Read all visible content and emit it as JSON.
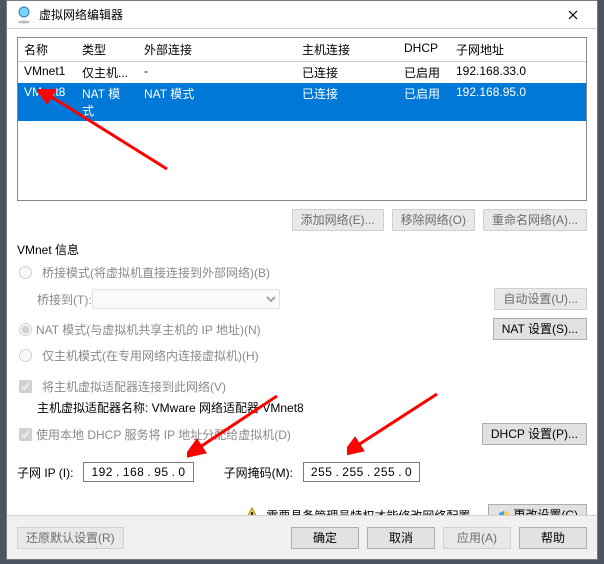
{
  "title": "虚拟网络编辑器",
  "columns": [
    "名称",
    "类型",
    "外部连接",
    "主机连接",
    "DHCP",
    "子网地址"
  ],
  "rows": [
    {
      "name": "VMnet1",
      "type": "仅主机...",
      "ext": "-",
      "host": "已连接",
      "dhcp": "已启用",
      "subnet": "192.168.33.0"
    },
    {
      "name": "VMnet8",
      "type": "NAT 模式",
      "ext": "NAT 模式",
      "host": "已连接",
      "dhcp": "已启用",
      "subnet": "192.168.95.0"
    }
  ],
  "btns": {
    "add": "添加网络(E)...",
    "remove": "移除网络(O)",
    "rename": "重命名网络(A)..."
  },
  "section": "VMnet 信息",
  "modes": {
    "bridge": "桥接模式(将虚拟机直接连接到外部网络)(B)",
    "bridge_to": "桥接到(T):",
    "bridge_auto": "自动设置(U)...",
    "nat": "NAT 模式(与虚拟机共享主机的 IP 地址)(N)",
    "nat_btn": "NAT 设置(S)...",
    "hostonly": "仅主机模式(在专用网络内连接虚拟机)(H)"
  },
  "checks": {
    "hostadapter": "将主机虚拟适配器连接到此网络(V)",
    "adapter_label": "主机虚拟适配器名称: VMware 网络适配器 VMnet8",
    "dhcp": "使用本地 DHCP 服务将 IP 地址分配给虚拟机(D)",
    "dhcp_btn": "DHCP 设置(P)..."
  },
  "ip": {
    "label": "子网 IP (I):",
    "o1": "192",
    "o2": "168",
    "o3": "95",
    "o4": "0"
  },
  "mask": {
    "label": "子网掩码(M):",
    "o1": "255",
    "o2": "255",
    "o3": "255",
    "o4": "0"
  },
  "warning": "需要具备管理员特权才能修改网络配置。",
  "change": "更改设置(C)",
  "restore": "还原默认设置(R)",
  "ok": "确定",
  "cancel": "取消",
  "apply": "应用(A)",
  "help": "帮助"
}
